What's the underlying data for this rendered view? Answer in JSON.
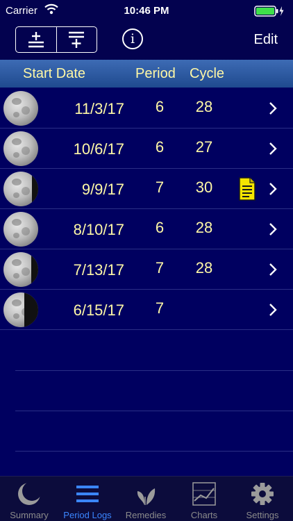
{
  "status_bar": {
    "carrier": "Carrier",
    "time": "10:46 PM"
  },
  "nav": {
    "info_symbol": "i",
    "edit_label": "Edit",
    "icons": [
      "add-log-icon",
      "insert-log-icon",
      "info-icon"
    ]
  },
  "columns": {
    "start_date": "Start Date",
    "period": "Period",
    "cycle": "Cycle"
  },
  "logs": [
    {
      "date": "11/3/17",
      "period": "6",
      "cycle": "28",
      "moon": "full-moon-icon",
      "note": false
    },
    {
      "date": "10/6/17",
      "period": "6",
      "cycle": "27",
      "moon": "full-moon-icon",
      "note": false
    },
    {
      "date": "9/9/17",
      "period": "7",
      "cycle": "30",
      "moon": "waning-gibbous-icon",
      "note": true
    },
    {
      "date": "8/10/17",
      "period": "6",
      "cycle": "28",
      "moon": "full-moon-icon",
      "note": false
    },
    {
      "date": "7/13/17",
      "period": "7",
      "cycle": "28",
      "moon": "waning-gibbous-icon",
      "note": false
    },
    {
      "date": "6/15/17",
      "period": "7",
      "cycle": "",
      "moon": "last-quarter-icon",
      "note": false
    }
  ],
  "tabs": [
    {
      "label": "Summary",
      "icon": "moon-icon",
      "active": false
    },
    {
      "label": "Period Logs",
      "icon": "list-icon",
      "active": true
    },
    {
      "label": "Remedies",
      "icon": "leaf-icon",
      "active": false
    },
    {
      "label": "Charts",
      "icon": "chart-icon",
      "active": false
    },
    {
      "label": "Settings",
      "icon": "gear-icon",
      "active": false
    }
  ],
  "colors": {
    "background": "#000060",
    "header_text": "#fff8a6",
    "active_tab": "#3b86ff",
    "note_icon": "#f5e400"
  }
}
